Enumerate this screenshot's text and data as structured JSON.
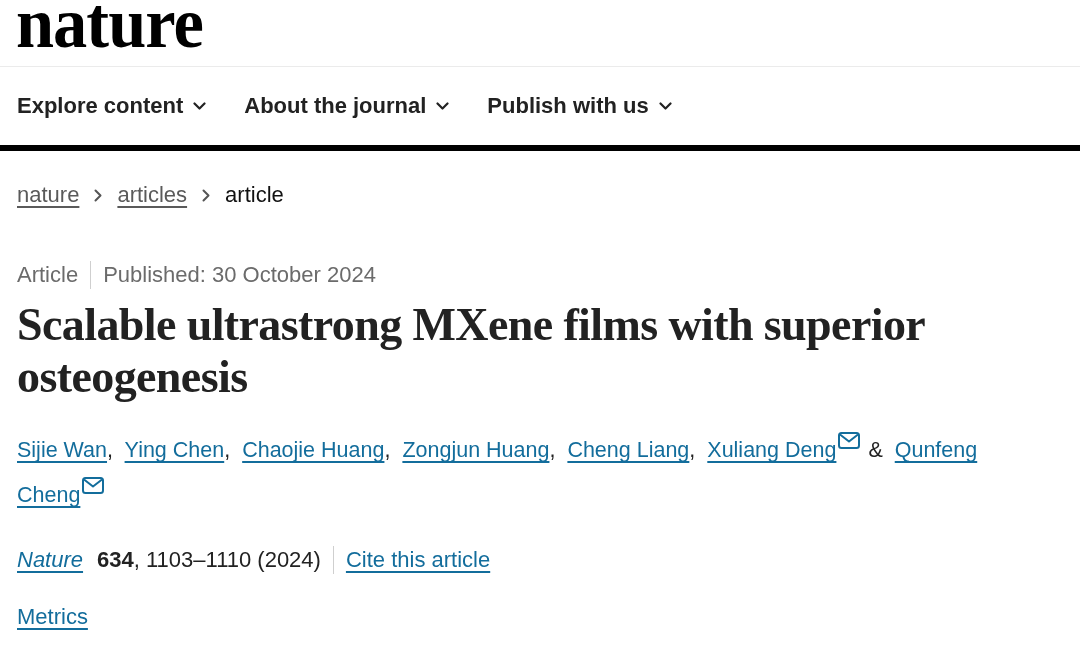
{
  "masthead": {
    "logo": "nature"
  },
  "nav": {
    "items": [
      {
        "label": "Explore content",
        "expanded": false
      },
      {
        "label": "About the journal",
        "expanded": false
      },
      {
        "label": "Publish with us",
        "expanded": false
      }
    ]
  },
  "breadcrumb": [
    {
      "label": "nature",
      "kind": "link"
    },
    {
      "label": "articles",
      "kind": "link"
    },
    {
      "label": "article",
      "kind": "current"
    }
  ],
  "article": {
    "type": "Article",
    "published": "Published: 30 October 2024",
    "title": "Scalable ultrastrong MXene films with superior osteogenesis",
    "authors": [
      {
        "name_lines": [
          "Sijie Wan"
        ],
        "corresponding": false,
        "separator": ","
      },
      {
        "name_lines": [
          "Ying Chen"
        ],
        "corresponding": false,
        "separator": ","
      },
      {
        "name_lines": [
          "Chaojie Huang"
        ],
        "corresponding": false,
        "separator": ","
      },
      {
        "name_lines": [
          "Zongjun Huang"
        ],
        "corresponding": false,
        "separator": ","
      },
      {
        "name_lines": [
          "Cheng Liang"
        ],
        "corresponding": false,
        "separator": ","
      },
      {
        "name_lines": [
          "Xuliang Deng"
        ],
        "corresponding": true,
        "separator": "&"
      },
      {
        "name_lines": [
          "Qunfeng",
          "Cheng"
        ],
        "corresponding": true
      }
    ],
    "citation": {
      "journal": "Nature",
      "details": "**634**, 1103–1110 (2024)",
      "cite_link": "Cite this article"
    },
    "metrics_link": "Metrics"
  }
}
